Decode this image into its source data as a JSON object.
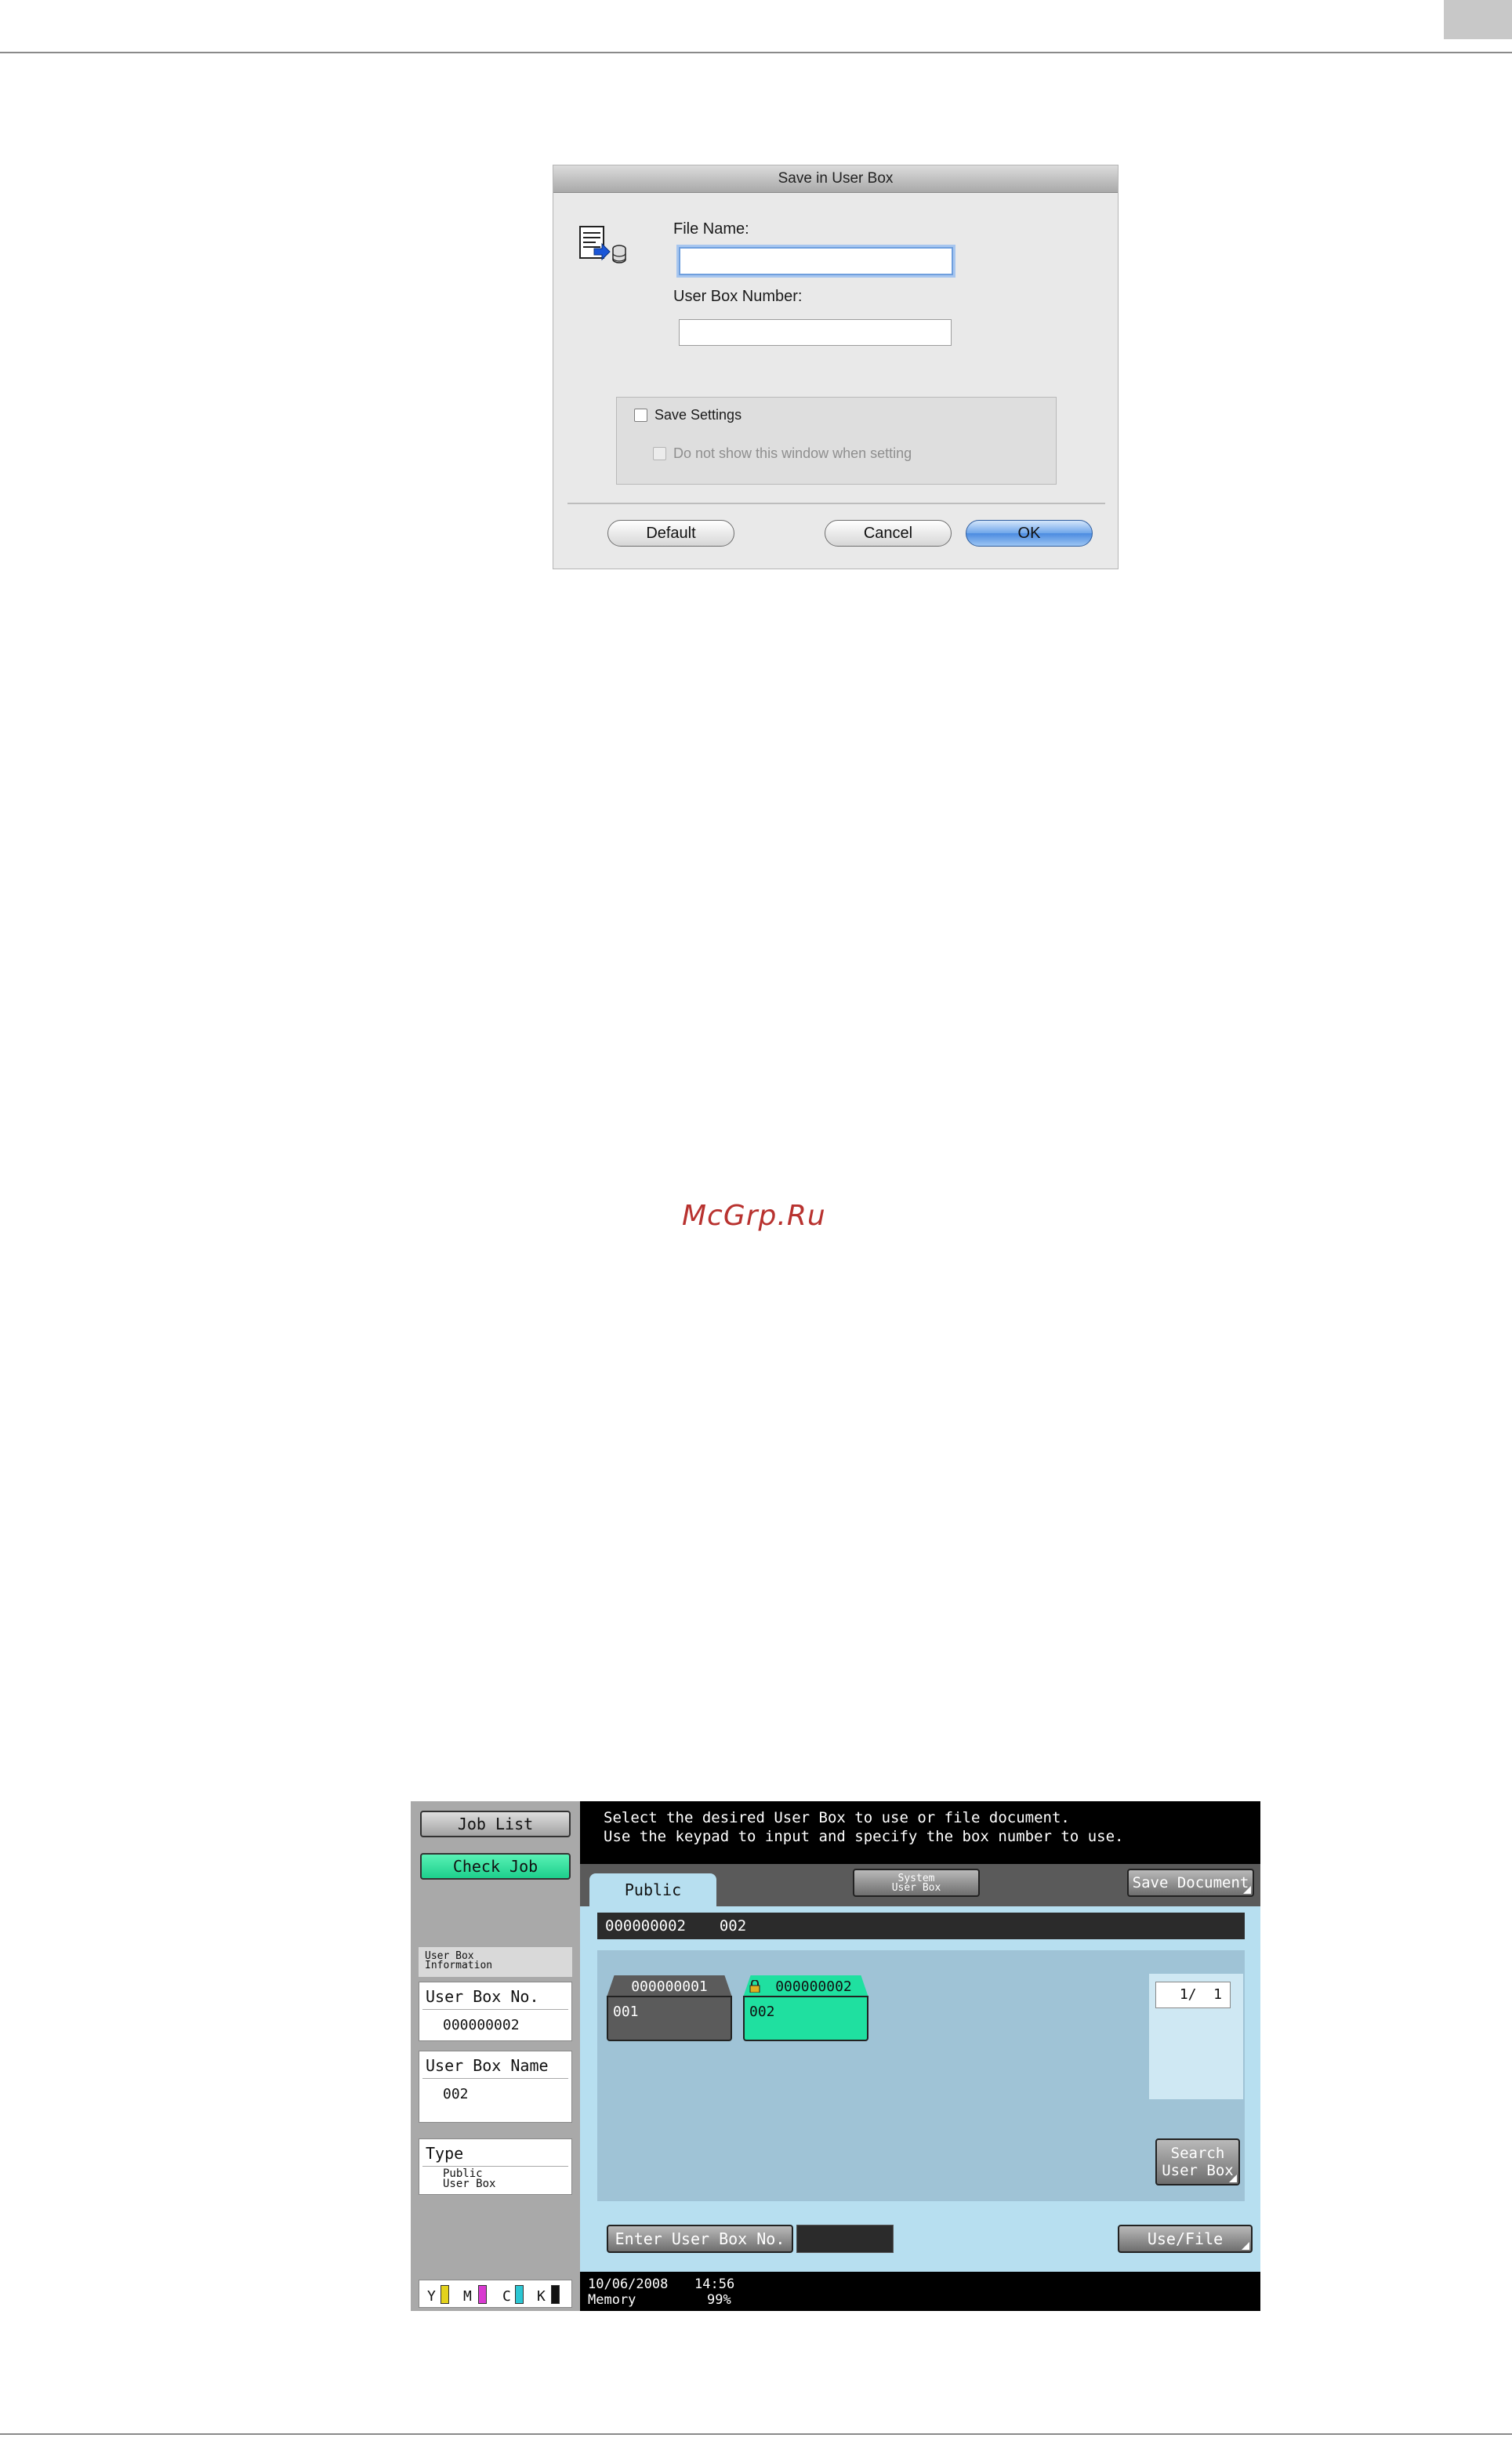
{
  "dialog": {
    "title": "Save in User Box",
    "file_name_label": "File Name:",
    "file_name_value": "",
    "user_box_number_label": "User Box Number:",
    "user_box_number_value": "",
    "save_settings_label": "Save Settings",
    "save_settings_checked": false,
    "dont_show_label": "Do not show this window when setting",
    "dont_show_checked": false,
    "buttons": {
      "default": "Default",
      "cancel": "Cancel",
      "ok": "OK"
    },
    "icon": "save-to-box-icon"
  },
  "watermark": "McGrp.Ru",
  "panel": {
    "left": {
      "job_list": "Job List",
      "check_job": "Check Job",
      "info_header_line1": "User Box",
      "info_header_line2": "Information",
      "box_no_label": "User Box No.",
      "box_no_value": "000000002",
      "box_name_label": "User Box Name",
      "box_name_value": "002",
      "type_label": "Type",
      "type_value_line1": "Public",
      "type_value_line2": "User Box",
      "toner": {
        "y": "Y",
        "m": "M",
        "c": "C",
        "k": "K"
      }
    },
    "message_line1": "Select the desired User Box to use or file document.",
    "message_line2": "Use the keypad to input and specify the box number to use.",
    "tabs": {
      "public": "Public",
      "system_line1": "System",
      "system_line2": "User Box"
    },
    "save_document": "Save Document",
    "selected": {
      "number": "000000002",
      "name": "002"
    },
    "boxes": [
      {
        "number": "000000001",
        "name": "001",
        "locked": false,
        "selected": false
      },
      {
        "number": "000000002",
        "name": "002",
        "locked": true,
        "selected": true
      }
    ],
    "pager": "1/  1",
    "search_line1": "Search",
    "search_line2": "User Box",
    "enter_box_no": "Enter User Box No.",
    "use_file": "Use/File",
    "status": {
      "date": "10/06/2008",
      "time": "14:56",
      "memory_label": "Memory",
      "memory_value": "99%"
    },
    "colors": {
      "accent_green": "#1dcf8c",
      "content_blue": "#b7dff0",
      "toner_y": "#e3d21c",
      "toner_m": "#d83ad0",
      "toner_c": "#2bc6d3",
      "toner_k": "#111111"
    }
  }
}
